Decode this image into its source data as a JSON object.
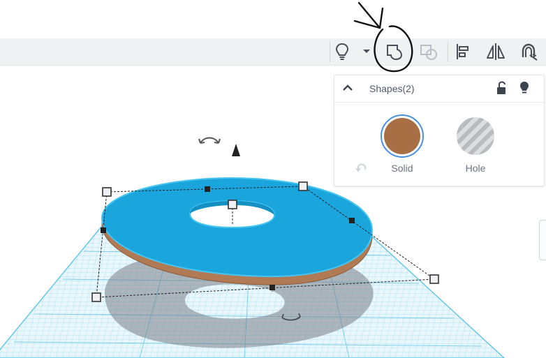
{
  "toolbar": {
    "items": [
      {
        "name": "lightbulb-icon"
      },
      {
        "name": "dropdown-caret-icon"
      },
      {
        "name": "group-icon"
      },
      {
        "name": "ungroup-icon"
      },
      {
        "name": "align-icon"
      },
      {
        "name": "mirror-icon"
      },
      {
        "name": "cruise-magnet-icon"
      }
    ]
  },
  "inspector": {
    "title": "Shapes(2)",
    "options": {
      "solid_label": "Solid",
      "hole_label": "Hole"
    }
  },
  "colors": {
    "solid_swatch": "#a86f45",
    "selected_ring": "#4a90e2",
    "torus_top": "#1aa6dd",
    "torus_edge": "#b07a55",
    "grid": "#8fd3ec"
  }
}
